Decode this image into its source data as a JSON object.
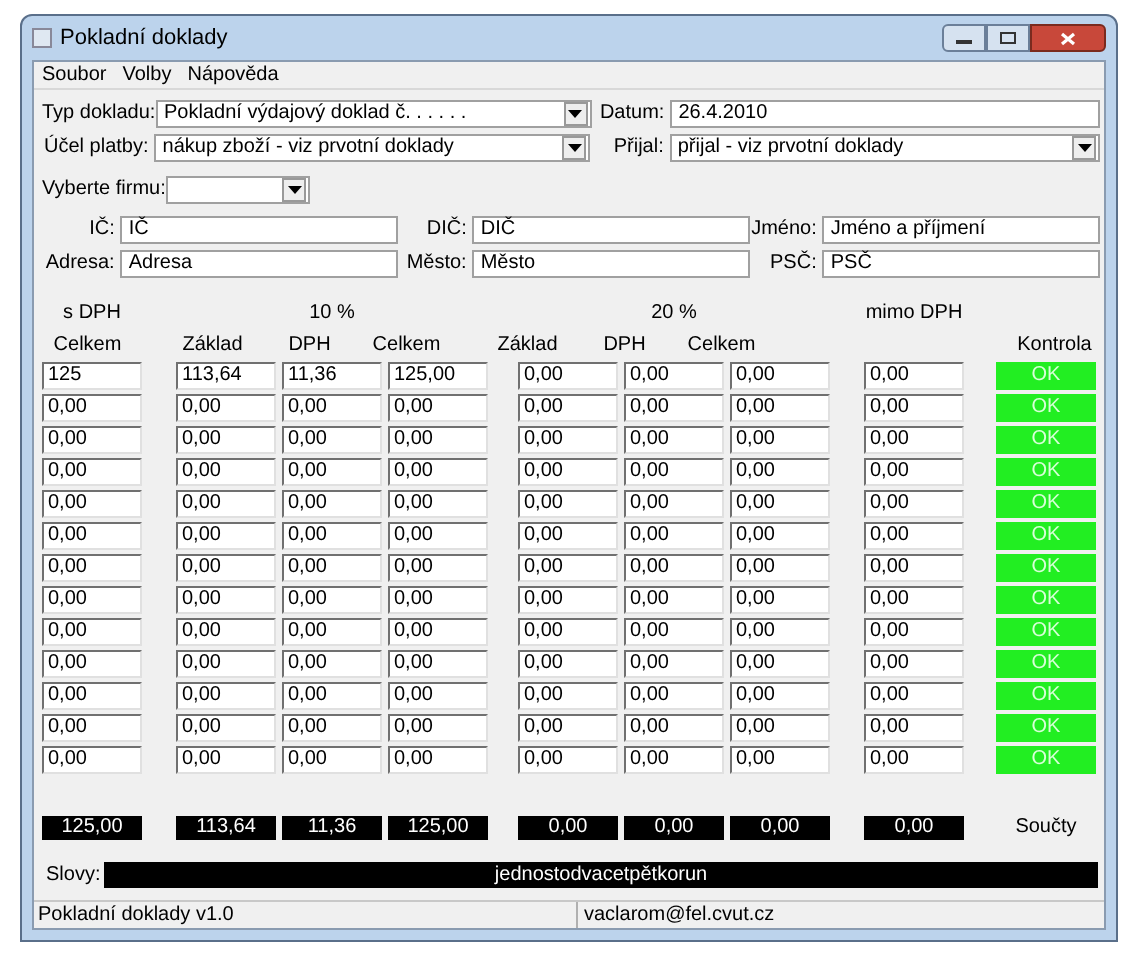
{
  "window": {
    "title": "Pokladní doklady"
  },
  "menu": [
    "Soubor",
    "Volby",
    "Nápověda"
  ],
  "form": {
    "type": {
      "label": "Typ dokladu:",
      "value": "Pokladní výdajový doklad č. . . . . ."
    },
    "date": {
      "label": "Datum:",
      "value": "26.4.2010"
    },
    "purpose": {
      "label": "Účel platby:",
      "value": "nákup zboží - viz prvotní doklady"
    },
    "received": {
      "label": "Přijal:",
      "value": "přijal - viz prvotní doklady"
    },
    "company": {
      "label": "Vyberte firmu:"
    },
    "fields": [
      {
        "label": "IČ:",
        "value": "IČ"
      },
      {
        "label": "DIČ:",
        "value": "DIČ"
      },
      {
        "label": "Jméno:",
        "value": "Jméno a příjmení"
      },
      {
        "label": "Adresa:",
        "value": "Adresa"
      },
      {
        "label": "Město:",
        "value": "Město"
      },
      {
        "label": "PSČ:",
        "value": "PSČ"
      }
    ]
  },
  "table": {
    "groups": [
      "s DPH",
      "10 %",
      "20 %",
      "mimo DPH"
    ],
    "column_headers": [
      "Celkem",
      "Základ",
      "DPH",
      "Celkem",
      "Základ",
      "DPH",
      "Celkem"
    ],
    "control_header": "Kontrola",
    "rows": [
      {
        "cells": [
          "125",
          "113,64",
          "11,36",
          "125,00",
          "0,00",
          "0,00",
          "0,00",
          "0,00"
        ],
        "control": {
          "label": "OK",
          "ok": true
        }
      },
      {
        "cells": [
          "0,00",
          "0,00",
          "0,00",
          "0,00",
          "0,00",
          "0,00",
          "0,00",
          "0,00"
        ],
        "control": {
          "label": "OK",
          "ok": true
        }
      },
      {
        "cells": [
          "0,00",
          "0,00",
          "0,00",
          "0,00",
          "0,00",
          "0,00",
          "0,00",
          "0,00"
        ],
        "control": {
          "label": "OK",
          "ok": true
        }
      },
      {
        "cells": [
          "0,00",
          "0,00",
          "0,00",
          "0,00",
          "0,00",
          "0,00",
          "0,00",
          "0,00"
        ],
        "control": {
          "label": "OK",
          "ok": true
        }
      },
      {
        "cells": [
          "0,00",
          "0,00",
          "0,00",
          "0,00",
          "0,00",
          "0,00",
          "0,00",
          "0,00"
        ],
        "control": {
          "label": "OK",
          "ok": true
        }
      },
      {
        "cells": [
          "0,00",
          "0,00",
          "0,00",
          "0,00",
          "0,00",
          "0,00",
          "0,00",
          "0,00"
        ],
        "control": {
          "label": "OK",
          "ok": true
        }
      },
      {
        "cells": [
          "0,00",
          "0,00",
          "0,00",
          "0,00",
          "0,00",
          "0,00",
          "0,00",
          "0,00"
        ],
        "control": {
          "label": "OK",
          "ok": true
        }
      },
      {
        "cells": [
          "0,00",
          "0,00",
          "0,00",
          "0,00",
          "0,00",
          "0,00",
          "0,00",
          "0,00"
        ],
        "control": {
          "label": "OK",
          "ok": true
        }
      },
      {
        "cells": [
          "0,00",
          "0,00",
          "0,00",
          "0,00",
          "0,00",
          "0,00",
          "0,00",
          "0,00"
        ],
        "control": {
          "label": "OK",
          "ok": true
        }
      },
      {
        "cells": [
          "0,00",
          "0,00",
          "0,00",
          "0,00",
          "0,00",
          "0,00",
          "0,00",
          "0,00"
        ],
        "control": {
          "label": "OK",
          "ok": true
        }
      },
      {
        "cells": [
          "0,00",
          "0,00",
          "0,00",
          "0,00",
          "0,00",
          "0,00",
          "0,00",
          "0,00"
        ],
        "control": {
          "label": "OK",
          "ok": true
        }
      },
      {
        "cells": [
          "0,00",
          "0,00",
          "0,00",
          "0,00",
          "0,00",
          "0,00",
          "0,00",
          "0,00"
        ],
        "control": {
          "label": "OK",
          "ok": true
        }
      },
      {
        "cells": [
          "0,00",
          "0,00",
          "0,00",
          "0,00",
          "0,00",
          "0,00",
          "0,00",
          "0,00"
        ],
        "control": {
          "label": "OK",
          "ok": true
        }
      }
    ],
    "totals": [
      "125,00",
      "113,64",
      "11,36",
      "125,00",
      "0,00",
      "0,00",
      "0,00",
      "0,00"
    ],
    "totals_label": "Součty"
  },
  "words": {
    "label": "Slovy:",
    "value": "jednostodvacetpětkorun"
  },
  "status_bar": [
    "Pokladní doklady v1.0",
    "vaclarom@fel.cvut.cz"
  ]
}
